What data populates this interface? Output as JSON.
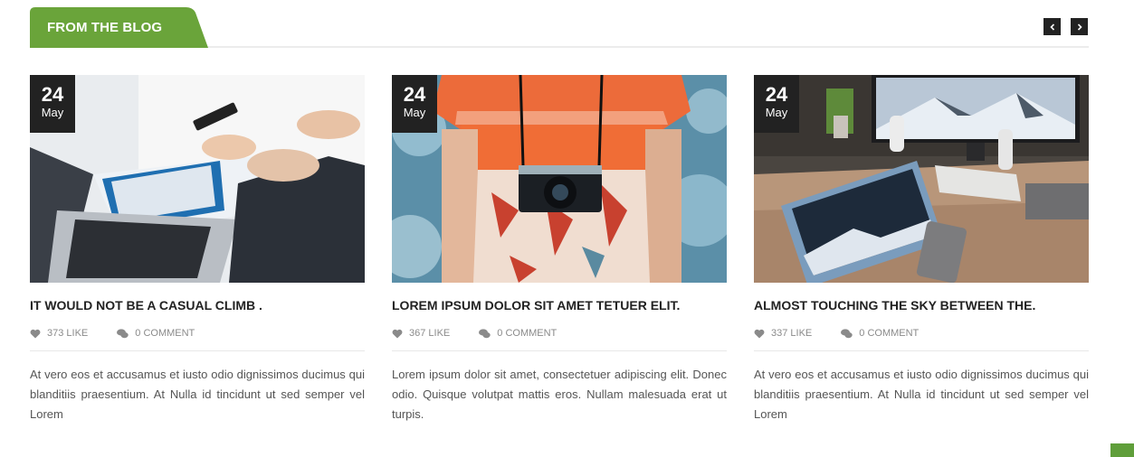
{
  "section": {
    "title": "FROM THE BLOG",
    "accent_color": "#6aa43a",
    "prev_icon": "chevron-left-icon",
    "next_icon": "chevron-right-icon"
  },
  "posts": [
    {
      "day": "24",
      "month": "May",
      "title": "IT WOULD NOT BE A CASUAL CLIMB .",
      "likes": "373 LIKE",
      "comments": "0 COMMENT",
      "excerpt": "At vero eos et accusamus et iusto odio dignissimos ducimus qui blanditiis praesentium. At Nulla id tincidunt ut sed semper vel Lorem"
    },
    {
      "day": "24",
      "month": "May",
      "title": "LOREM IPSUM DOLOR SIT AMET TETUER ELIT.",
      "likes": "367 LIKE",
      "comments": "0 COMMENT",
      "excerpt": "Lorem ipsum dolor sit amet, consectetuer adipiscing elit. Donec odio. Quisque volutpat mattis eros. Nullam malesuada erat ut turpis."
    },
    {
      "day": "24",
      "month": "May",
      "title": "ALMOST TOUCHING THE SKY BETWEEN THE.",
      "likes": "337 LIKE",
      "comments": "0 COMMENT",
      "excerpt": "At vero eos et accusamus et iusto odio dignissimos ducimus qui blanditiis praesentium. At Nulla id tincidunt ut sed semper vel Lorem"
    }
  ]
}
